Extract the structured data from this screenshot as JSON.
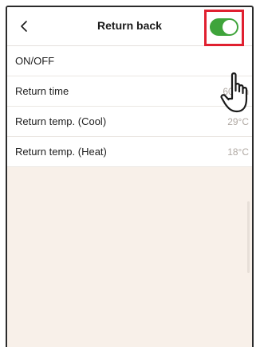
{
  "header": {
    "back_label": "<",
    "title": "Return back"
  },
  "settings": [
    {
      "label": "ON/OFF",
      "state": "on"
    },
    {
      "label": "Return time",
      "value": "60min"
    },
    {
      "label": "Return temp.  (Cool)",
      "value": "29°C"
    },
    {
      "label": "Return temp.  (Heat)",
      "value": "18°C"
    }
  ],
  "colors": {
    "toggle_on": "#3fa43b",
    "highlight": "#e02030",
    "screen_background": "#f8f0e9"
  },
  "icons": {
    "back": "chevron-left-icon",
    "pointer": "hand-pointer-icon"
  }
}
